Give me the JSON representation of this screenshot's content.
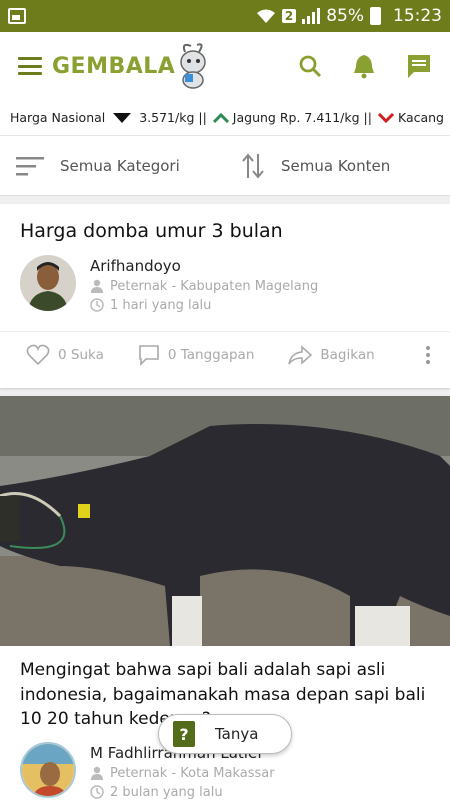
{
  "status_bar": {
    "battery": "85%",
    "time": "15:23",
    "sim": "2"
  },
  "app_bar": {
    "logo_text": "GEMBALA"
  },
  "ticker": {
    "label": "Harga Nasional",
    "items": [
      {
        "text": "3.571/kg ||",
        "trend": ""
      },
      {
        "text": "Jagung Rp. 7.411/kg ||",
        "trend": "up"
      },
      {
        "text": "Kacang",
        "trend": "down"
      }
    ]
  },
  "filters": {
    "category": "Semua Kategori",
    "content": "Semua Konten"
  },
  "posts": [
    {
      "title": "Harga domba umur 3 bulan",
      "author": "Arifhandoyo",
      "role": "Peternak - Kabupaten Magelang",
      "time": "1 hari yang lalu",
      "likes": "0 Suka",
      "replies": "0 Tanggapan",
      "share": "Bagikan"
    },
    {
      "title": "Mengingat bahwa sapi bali adalah sapi asli indonesia, bagaimanakah masa depan sapi bali 10 20 tahun kedepan?",
      "author": "M Fadhlirrahman Latief",
      "role": "Peternak - Kota Makassar",
      "time": "2 bulan yang lalu"
    }
  ],
  "fab": {
    "label": "Tanya",
    "icon_char": "?"
  },
  "colors": {
    "status_bar": "#6f7c1c",
    "accent": "#8aa031",
    "trend_up": "#2e8b57",
    "trend_down": "#cc2222"
  }
}
